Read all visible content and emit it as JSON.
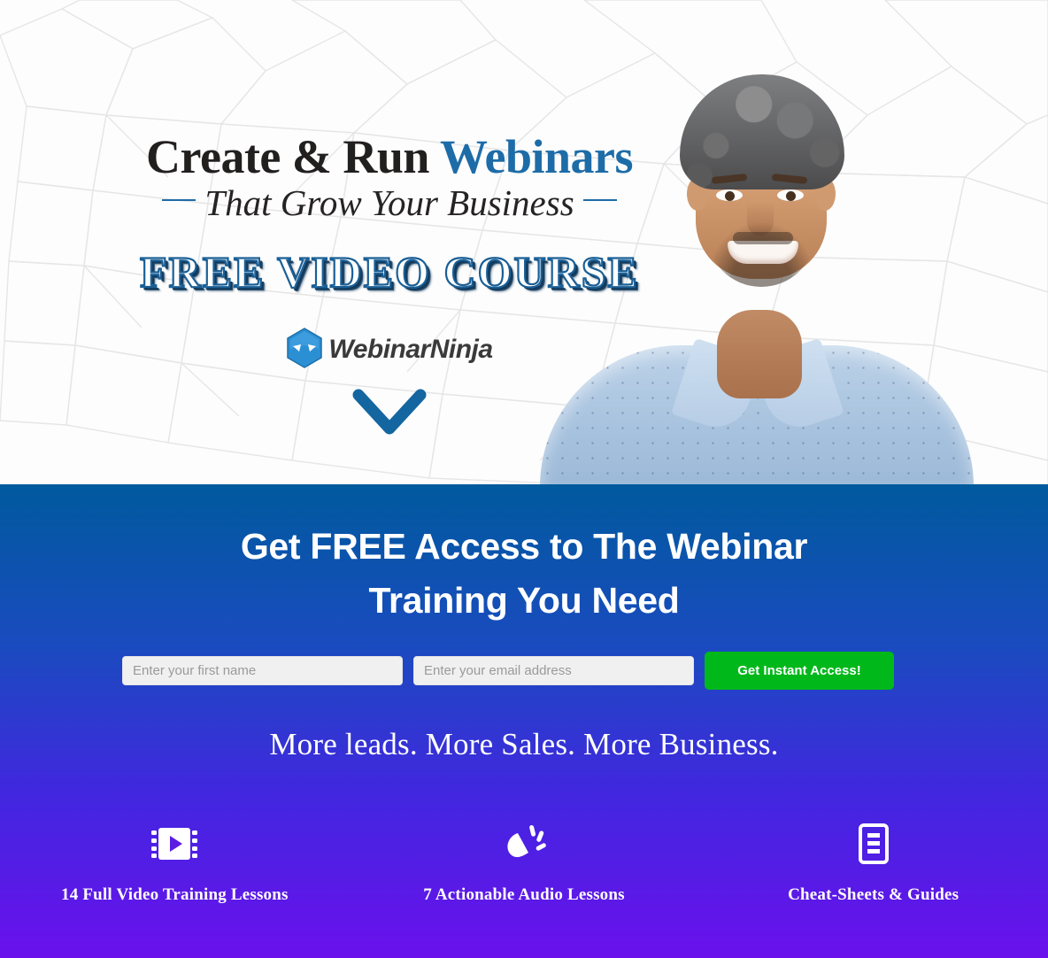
{
  "hero": {
    "headline_part1": "Create & Run ",
    "headline_accent": "Webinars",
    "subline": "That Grow Your Business",
    "badge": "FREE VIDEO COURSE",
    "logo_text": "WebinarNinja",
    "scroll_hint_icon": "chevron-down-icon",
    "photo_alt": "smiling-man-in-blue-shirt"
  },
  "cta": {
    "title_line1": "Get FREE Access to The Webinar",
    "title_line2": "Training You Need",
    "first_name_placeholder": "Enter your first name",
    "first_name_value": "",
    "email_placeholder": "Enter your email address",
    "email_value": "",
    "button_label": "Get Instant Access!",
    "tagline": "More leads. More Sales. More Business.",
    "features": [
      {
        "icon": "film-strip-play-icon",
        "label": "14 Full Video Training Lessons"
      },
      {
        "icon": "megaphone-audio-icon",
        "label": "7 Actionable Audio Lessons"
      },
      {
        "icon": "document-lines-icon",
        "label": "Cheat-Sheets & Guides"
      }
    ]
  },
  "colors": {
    "hero_bg": "#fdfdfd",
    "headline_dark": "#221f1f",
    "headline_blue": "#1d6ca8",
    "badge_stroke": "#1a5f96",
    "gradient_top": "#005a9e",
    "gradient_bottom": "#6a11ec",
    "cta_green": "#00b81a",
    "field_bg": "#f0f0f0"
  }
}
